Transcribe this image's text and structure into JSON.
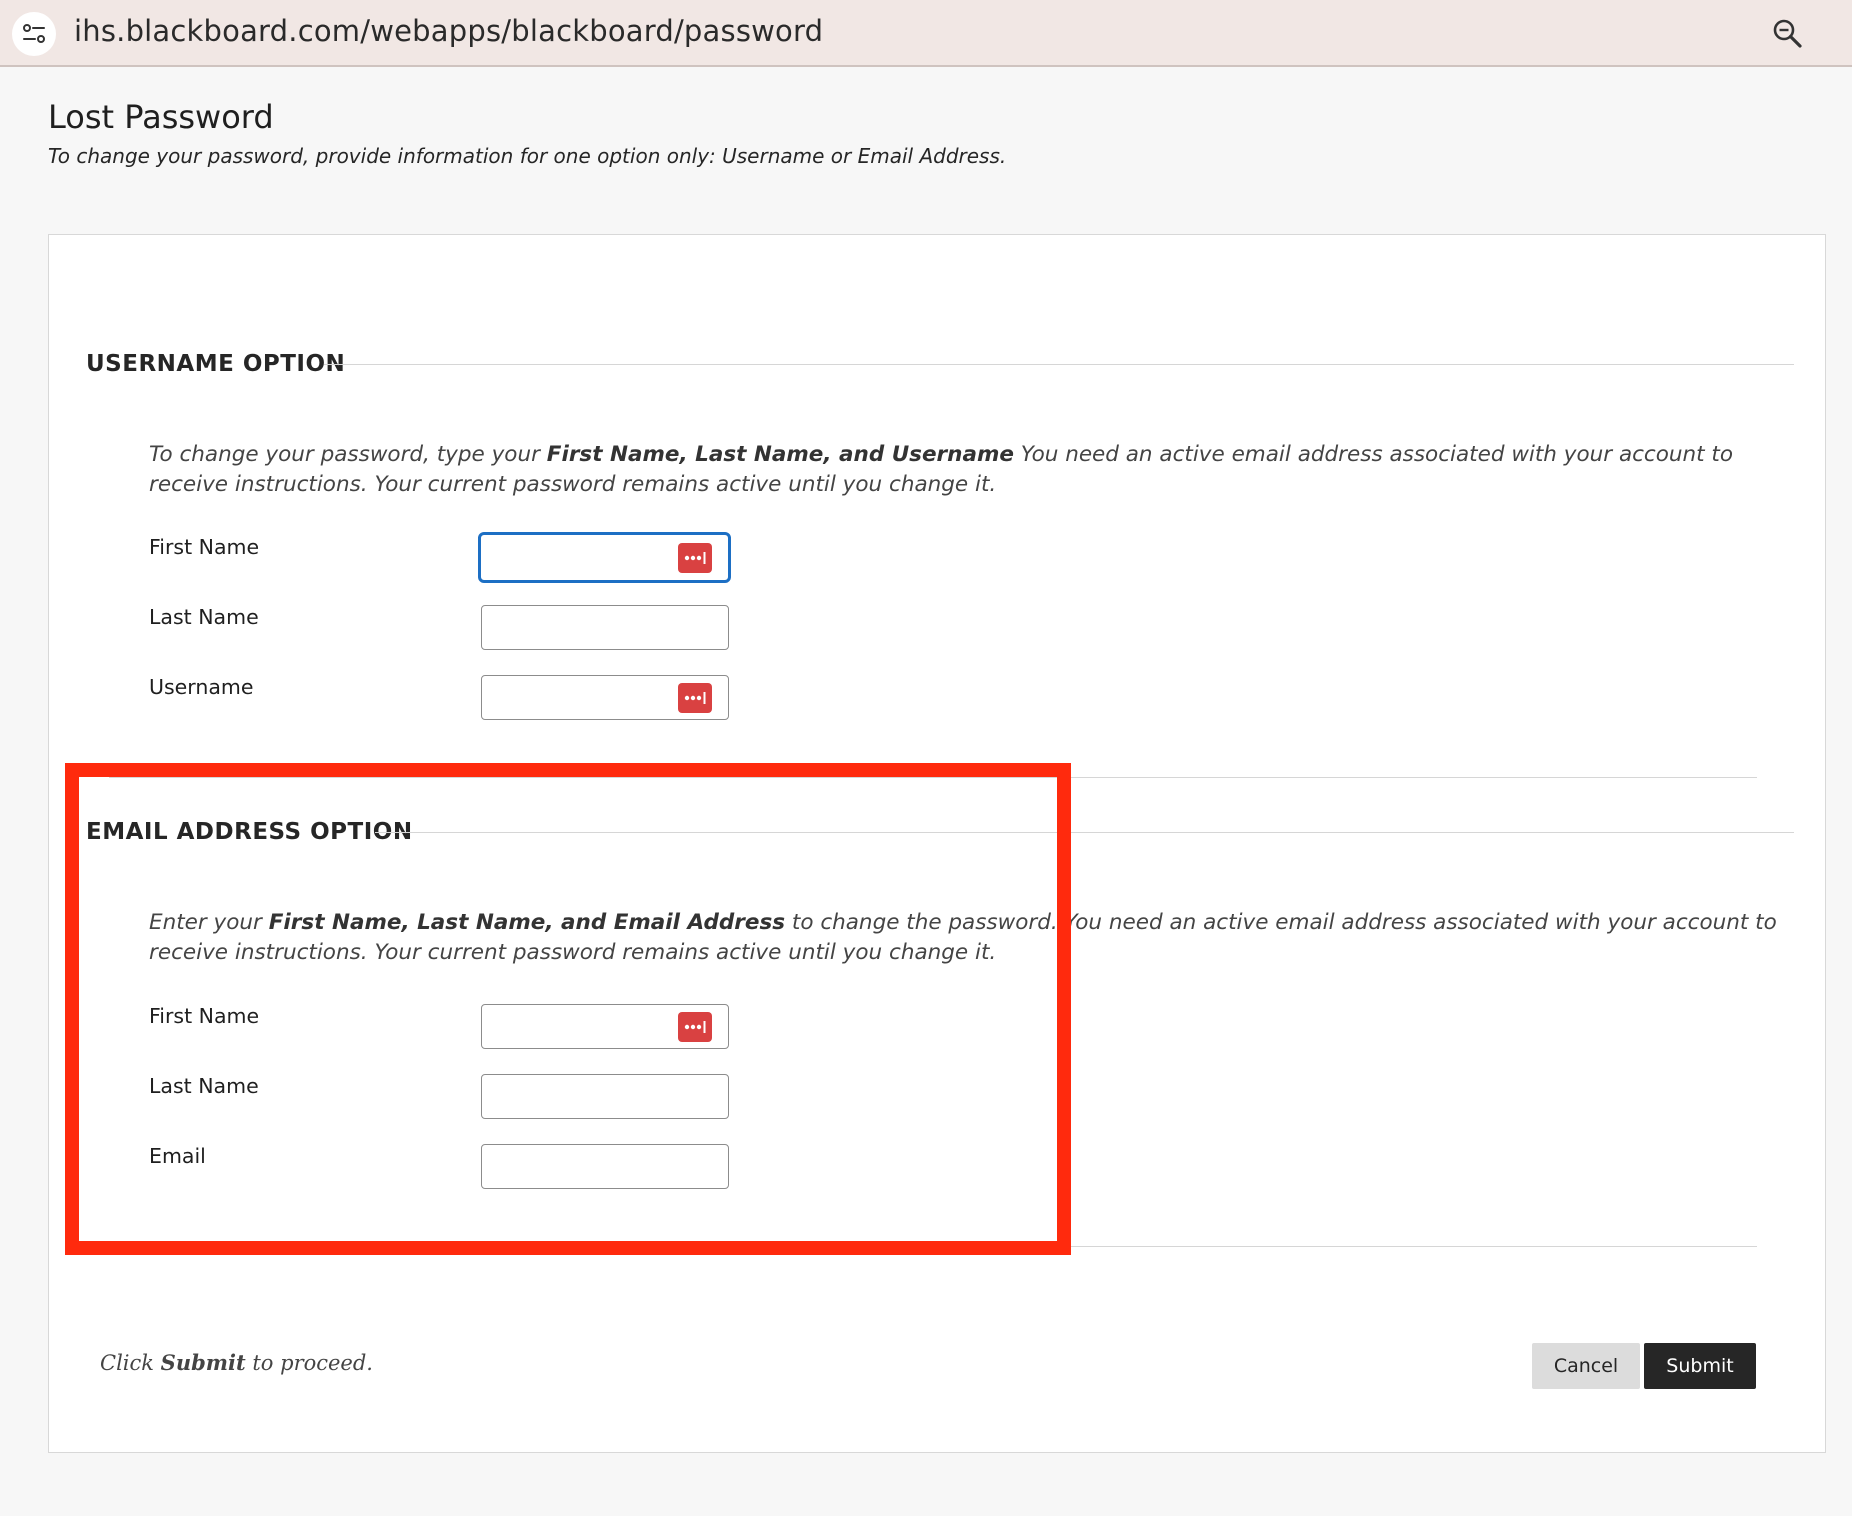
{
  "browser": {
    "url": "ihs.blackboard.com/webapps/blackboard/password",
    "site_icon": "tune-icon",
    "zoom_icon": "zoom-icon"
  },
  "page": {
    "title": "Lost Password",
    "subtitle": "To change your password, provide information for one option only: Username or Email Address."
  },
  "username_option": {
    "heading": "USERNAME OPTION",
    "instructions": {
      "before": "To change your password, type your ",
      "bold": "First Name, Last Name, and Username",
      "after": " You need an active email address associated with your account to receive instructions. Your current password remains active until you change it."
    },
    "fields": [
      {
        "label": "First Name",
        "value": "",
        "focused": true,
        "password_manager_icon": true
      },
      {
        "label": "Last Name",
        "value": "",
        "focused": false,
        "password_manager_icon": false
      },
      {
        "label": "Username",
        "value": "",
        "focused": false,
        "password_manager_icon": true
      }
    ]
  },
  "email_option": {
    "heading": "EMAIL ADDRESS OPTION",
    "instructions": {
      "before": "Enter your ",
      "bold": "First Name, Last Name, and Email Address",
      "after": " to change the password. You need an active email address associated with your account to receive instructions. Your current password remains active until you change it."
    },
    "fields": [
      {
        "label": "First Name",
        "value": "",
        "focused": false,
        "password_manager_icon": true
      },
      {
        "label": "Last Name",
        "value": "",
        "focused": false,
        "password_manager_icon": false
      },
      {
        "label": "Email",
        "value": "",
        "focused": false,
        "password_manager_icon": false
      }
    ]
  },
  "footer": {
    "prefix": "Click ",
    "bold": "Submit",
    "suffix": " to proceed."
  },
  "buttons": {
    "cancel": "Cancel",
    "submit": "Submit"
  },
  "colors": {
    "highlight": "#ff2a0d",
    "focus_ring": "#1d6fc4",
    "password_manager": "#d94141",
    "submit_bg": "#262626"
  }
}
